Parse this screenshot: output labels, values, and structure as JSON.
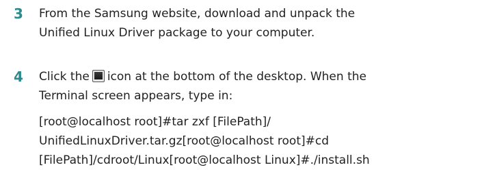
{
  "steps": [
    {
      "number": "3",
      "lines": [
        "From the Samsung website, download and unpack the",
        "Unified Linux Driver package to your computer."
      ]
    },
    {
      "number": "4",
      "line1_before_icon": "Click the",
      "icon": "terminal-icon",
      "line1_after_icon": "icon at the bottom of the desktop. When the",
      "line2": "Terminal screen appears, type in:",
      "code_lines": [
        "[root@localhost root]#tar zxf [FilePath]/",
        "UnifiedLinuxDriver.tar.gz[root@localhost root]#cd",
        "[FilePath]/cdroot/Linux[root@localhost Linux]#./install.sh"
      ]
    }
  ]
}
